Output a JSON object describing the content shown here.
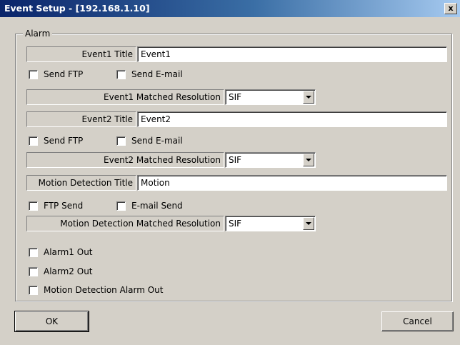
{
  "window": {
    "title": "Event Setup - [192.168.1.10]",
    "close_glyph": "x"
  },
  "group": {
    "legend": "Alarm"
  },
  "event1": {
    "title_label": "Event1 Title",
    "title_value": "Event1",
    "send_ftp": "Send FTP",
    "send_email": "Send E-mail",
    "resolution_label": "Event1 Matched Resolution",
    "resolution_value": "SIF"
  },
  "event2": {
    "title_label": "Event2 Title",
    "title_value": "Event2",
    "send_ftp": "Send FTP",
    "send_email": "Send E-mail",
    "resolution_label": "Event2 Matched Resolution",
    "resolution_value": "SIF"
  },
  "motion": {
    "title_label": "Motion Detection Title",
    "title_value": "Motion",
    "ftp_send": "FTP Send",
    "email_send": "E-mail Send",
    "resolution_label": "Motion Detection  Matched  Resolution",
    "resolution_value": "SIF"
  },
  "alarm_outputs": {
    "alarm1": "Alarm1 Out",
    "alarm2": "Alarm2 Out",
    "motion": "Motion Detection Alarm Out"
  },
  "buttons": {
    "ok": "OK",
    "cancel": "Cancel"
  },
  "colors": {
    "title_start": "#0a246a",
    "title_end": "#a6caf0",
    "face": "#d4d0c8"
  }
}
